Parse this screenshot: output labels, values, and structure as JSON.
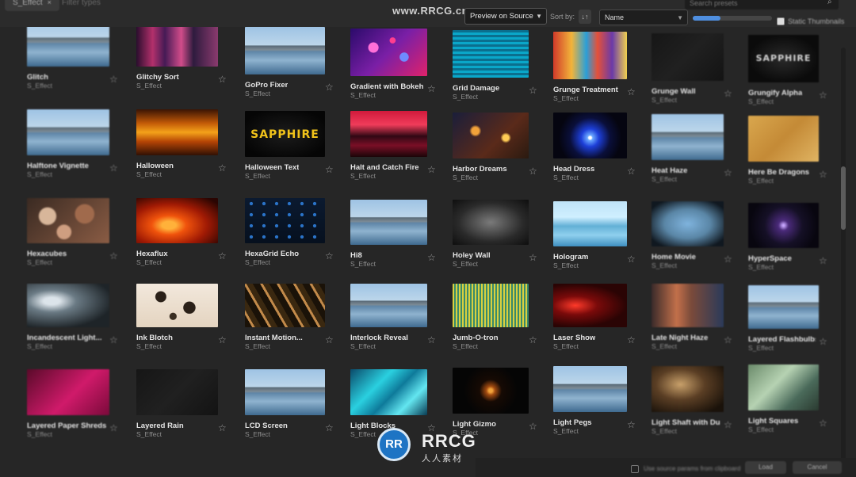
{
  "header": {
    "tab_label": "S_Effect",
    "tab_close": "×",
    "filter_label": "Filter types",
    "watermark_url": "www.RRCG.cn",
    "preview_dropdown": "Preview on Source",
    "sort_by_label": "Sort by:",
    "sort_icon": "↓↑",
    "sort_value": "Name",
    "zoom_level": 0.35,
    "search_placeholder": "Search presets",
    "static_thumbnails_label": "Static Thumbnails",
    "static_thumbnails_checked": true
  },
  "effects": [
    {
      "name": "Glitch",
      "category": "S_Effect",
      "icon": "city-river-thumbnail"
    },
    {
      "name": "Glitchy Sort",
      "category": "S_Effect",
      "icon": "glitch-pink-thumbnail"
    },
    {
      "name": "GoPro Fixer",
      "category": "S_Effect",
      "icon": "city-river-thumbnail"
    },
    {
      "name": "Gradient with Bokeh...",
      "category": "S_Effect",
      "icon": "bokeh-gradient-thumbnail"
    },
    {
      "name": "Grid Damage",
      "category": "S_Effect",
      "icon": "cyan-grid-thumbnail"
    },
    {
      "name": "Grunge Treatment",
      "category": "S_Effect",
      "icon": "grunge-thumbnail"
    },
    {
      "name": "Grunge Wall",
      "category": "S_Effect",
      "icon": "dark-thumbnail"
    },
    {
      "name": "Grungify Alpha",
      "category": "S_Effect",
      "icon": "sapphire-logo-thumbnail"
    },
    {
      "name": "Halftone Vignette",
      "category": "S_Effect",
      "icon": "city-river-thumbnail"
    },
    {
      "name": "Halloween",
      "category": "S_Effect",
      "icon": "halloween-thumbnail"
    },
    {
      "name": "Halloween Text",
      "category": "S_Effect",
      "icon": "sapphire-text-thumbnail"
    },
    {
      "name": "Halt and Catch Fire",
      "category": "S_Effect",
      "icon": "fire-city-thumbnail"
    },
    {
      "name": "Harbor Dreams",
      "category": "S_Effect",
      "icon": "harbor-thumbnail"
    },
    {
      "name": "Head Dress",
      "category": "S_Effect",
      "icon": "blue-burst-thumbnail"
    },
    {
      "name": "Heat Haze",
      "category": "S_Effect",
      "icon": "city-river-thumbnail"
    },
    {
      "name": "Here Be Dragons",
      "category": "S_Effect",
      "icon": "paper-thumbnail"
    },
    {
      "name": "Hexacubes",
      "category": "S_Effect",
      "icon": "hexacubes-thumbnail"
    },
    {
      "name": "Hexaflux",
      "category": "S_Effect",
      "icon": "hexaflux-thumbnail"
    },
    {
      "name": "HexaGrid Echo",
      "category": "S_Effect",
      "icon": "hexagrid-thumbnail"
    },
    {
      "name": "Hi8",
      "category": "S_Effect",
      "icon": "city-river-thumbnail"
    },
    {
      "name": "Holey Wall",
      "category": "S_Effect",
      "icon": "holey-wall-thumbnail"
    },
    {
      "name": "Hologram",
      "category": "S_Effect",
      "icon": "hologram-thumbnail"
    },
    {
      "name": "Home Movie",
      "category": "S_Effect",
      "icon": "home-movie-thumbnail"
    },
    {
      "name": "HyperSpace",
      "category": "S_Effect",
      "icon": "hyperspace-thumbnail"
    },
    {
      "name": "Incandescent Light...",
      "category": "S_Effect",
      "icon": "incandescent-thumbnail"
    },
    {
      "name": "Ink Blotch",
      "category": "S_Effect",
      "icon": "ink-blotch-thumbnail"
    },
    {
      "name": "Instant Motion...",
      "category": "S_Effect",
      "icon": "motion-thumbnail"
    },
    {
      "name": "Interlock Reveal",
      "category": "S_Effect",
      "icon": "city-river-thumbnail"
    },
    {
      "name": "Jumb-O-tron",
      "category": "S_Effect",
      "icon": "jumbotron-thumbnail"
    },
    {
      "name": "Laser Show",
      "category": "S_Effect",
      "icon": "laser-thumbnail"
    },
    {
      "name": "Late Night Haze",
      "category": "S_Effect",
      "icon": "haze-thumbnail"
    },
    {
      "name": "Layered Flashbulbs",
      "category": "S_Effect",
      "icon": "city-river-thumbnail"
    },
    {
      "name": "Layered Paper Shreds",
      "category": "S_Effect",
      "icon": "magenta-thumbnail"
    },
    {
      "name": "Layered Rain",
      "category": "S_Effect",
      "icon": "dark-thumbnail"
    },
    {
      "name": "LCD Screen",
      "category": "S_Effect",
      "icon": "city-river-thumbnail"
    },
    {
      "name": "Light Blocks",
      "category": "S_Effect",
      "icon": "light-blocks-thumbnail"
    },
    {
      "name": "Light Gizmo",
      "category": "S_Effect",
      "icon": "gizmo-thumbnail"
    },
    {
      "name": "Light Pegs",
      "category": "S_Effect",
      "icon": "city-river-thumbnail"
    },
    {
      "name": "Light Shaft with Dust",
      "category": "S_Effect",
      "icon": "light-shaft-thumbnail"
    },
    {
      "name": "Light Squares",
      "category": "S_Effect",
      "icon": "light-squares-thumbnail"
    }
  ],
  "footer": {
    "checkbox_label": "Use source params from clipboard",
    "load_button": "Load",
    "cancel_button": "Cancel"
  },
  "watermark": {
    "logo": "RR",
    "brand": "RRCG",
    "sub": "人人素材"
  }
}
